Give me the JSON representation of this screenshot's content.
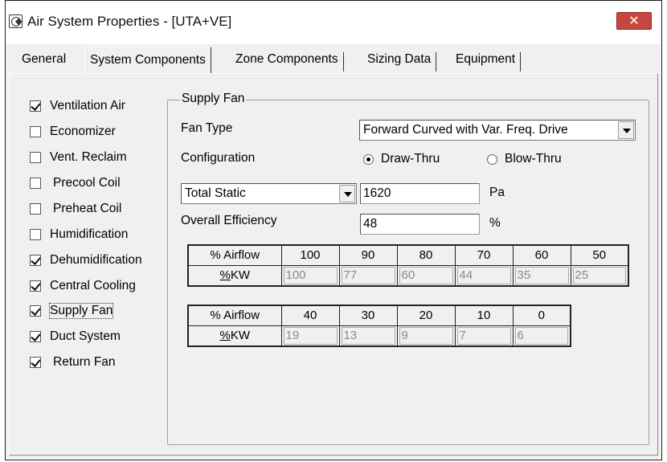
{
  "window": {
    "title": "Air System Properties - [UTA+VE]",
    "close_glyph": "✕"
  },
  "tabs": [
    {
      "label": "General",
      "active": false
    },
    {
      "label": "System Components",
      "active": true
    },
    {
      "label": "Zone Components",
      "active": false
    },
    {
      "label": "Sizing Data",
      "active": false
    },
    {
      "label": "Equipment",
      "active": false
    }
  ],
  "components": [
    {
      "label": "Ventilation Air",
      "checked": true
    },
    {
      "label": "Economizer",
      "checked": false
    },
    {
      "label": "Vent. Reclaim",
      "checked": false
    },
    {
      "label": "Precool Coil",
      "checked": false
    },
    {
      "label": "Preheat Coil",
      "checked": false
    },
    {
      "label": "Humidification",
      "checked": false
    },
    {
      "label": "Dehumidification",
      "checked": true
    },
    {
      "label": "Central Cooling",
      "checked": true
    },
    {
      "label": "Supply Fan",
      "checked": true
    },
    {
      "label": "Duct System",
      "checked": true
    },
    {
      "label": "Return Fan",
      "checked": true
    }
  ],
  "supply_fan": {
    "group_title": "Supply Fan",
    "fan_type_label": "Fan Type",
    "fan_type_value": "Forward Curved with Var. Freq. Drive",
    "configuration_label": "Configuration",
    "config_options": [
      {
        "label": "Draw-Thru",
        "selected": true
      },
      {
        "label": "Blow-Thru",
        "selected": false
      }
    ],
    "pressure_type_value": "Total Static",
    "pressure_value": "1620",
    "pressure_unit": "Pa",
    "efficiency_label": "Overall Efficiency",
    "efficiency_value": "48",
    "efficiency_unit": "%"
  },
  "airflow_table_1": {
    "airflow_header": "% Airflow",
    "kw_header": "%KW",
    "airflow": [
      "100",
      "90",
      "80",
      "70",
      "60",
      "50"
    ],
    "kw": [
      "100",
      "77",
      "60",
      "44",
      "35",
      "25"
    ]
  },
  "airflow_table_2": {
    "airflow_header": "% Airflow",
    "kw_header": "%KW",
    "airflow": [
      "40",
      "30",
      "20",
      "10",
      "0"
    ],
    "kw": [
      "19",
      "13",
      "9",
      "7",
      "6"
    ]
  }
}
